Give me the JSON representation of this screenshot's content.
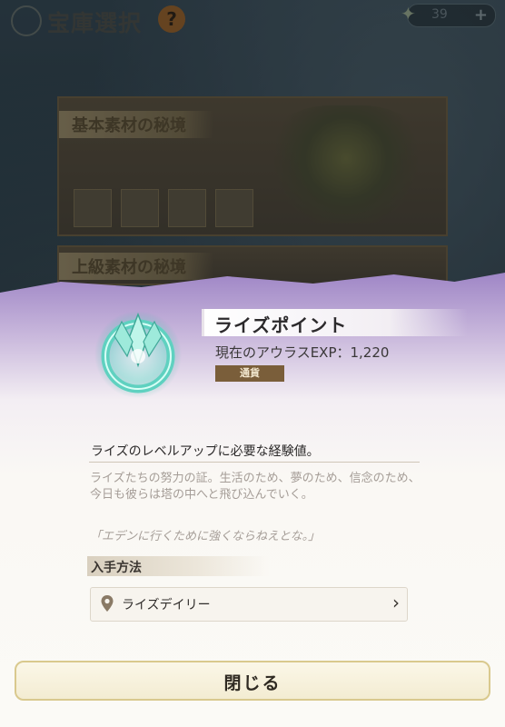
{
  "background": {
    "title": "宝庫選択",
    "help_glyph": "?",
    "currency": {
      "value": "39",
      "plus": "+"
    },
    "cards": [
      {
        "title": "基本素材の秘境"
      },
      {
        "title": "上級素材の秘境"
      }
    ]
  },
  "popup": {
    "item_name": "ライズポイント",
    "exp_text": "現在のアウラスEXP：1,220",
    "tag": "通貨",
    "description": "ライズのレベルアップに必要な経験値。",
    "flavor": "ライズたちの努力の証。生活のため、夢のため、信念のため、今日も彼らは塔の中へと飛び込んでいく。",
    "quote": "「エデンに行くために強くならねえとな。」",
    "acquisition": {
      "heading": "入手方法",
      "items": [
        {
          "label": "ライズデイリー"
        }
      ]
    },
    "close_label": "閉じる"
  },
  "colors": {
    "panel_top": "#9f86c6",
    "tag_bg": "#7a5e3a",
    "button_border": "#d9c98e"
  },
  "icons": [
    "app-logo-icon",
    "help-icon",
    "gem-icon",
    "plus-icon",
    "rise-point-crystal-icon",
    "location-pin-icon",
    "chevron-right-icon"
  ]
}
